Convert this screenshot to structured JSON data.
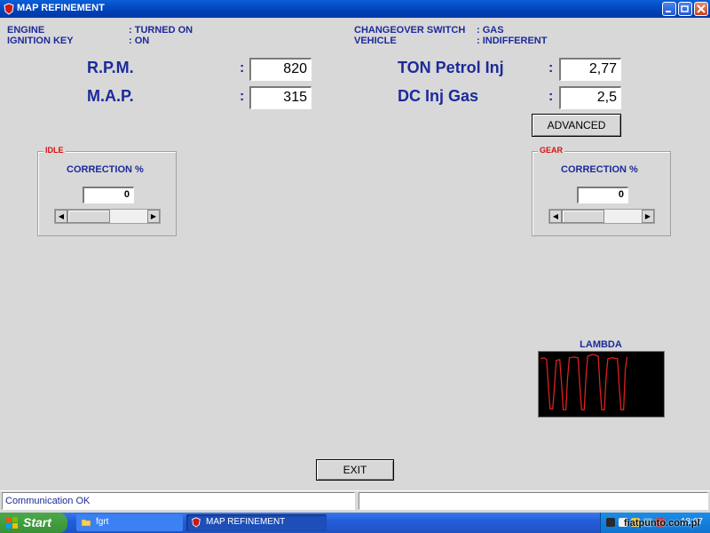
{
  "window": {
    "title": "MAP REFINEMENT"
  },
  "status_info": {
    "engine_label": "ENGINE",
    "engine_value": ": TURNED ON",
    "ignition_label": "IGNITION KEY",
    "ignition_value": ": ON",
    "changeover_label": "CHANGEOVER SWITCH",
    "changeover_value": ": GAS",
    "vehicle_label": "VEHICLE",
    "vehicle_value": ": INDIFFERENT"
  },
  "readings": {
    "rpm_label": "R.P.M.",
    "rpm_value": "820",
    "map_label": "M.A.P.",
    "map_value": "315",
    "ton_label": "TON Petrol Inj",
    "ton_value": "2,77",
    "dc_label": "DC Inj Gas",
    "dc_value": "2,5",
    "colon": ":"
  },
  "buttons": {
    "advanced": "ADVANCED",
    "exit": "EXIT"
  },
  "idle": {
    "legend": "IDLE",
    "title": "CORRECTION %",
    "value": "0"
  },
  "gear": {
    "legend": "GEAR",
    "title": "CORRECTION %",
    "value": "0"
  },
  "lambda": {
    "label": "LAMBDA",
    "trace_color": "#e02020"
  },
  "statusbar": {
    "message": "Communication OK",
    "secondary": ""
  },
  "taskbar": {
    "start": "Start",
    "tasks": [
      "fgrt",
      "MAP REFINEMENT"
    ],
    "clock": "18:07",
    "watermark": "fiatpunto.com.pl"
  },
  "icons": {
    "app": "app-icon",
    "folder": "folder-icon",
    "minimize": "minimize-icon",
    "maximize": "maximize-icon",
    "close": "close-icon"
  },
  "colors": {
    "label": "#1c2a9a",
    "legend": "#d81010",
    "titlebar": "#0a5fd8"
  }
}
